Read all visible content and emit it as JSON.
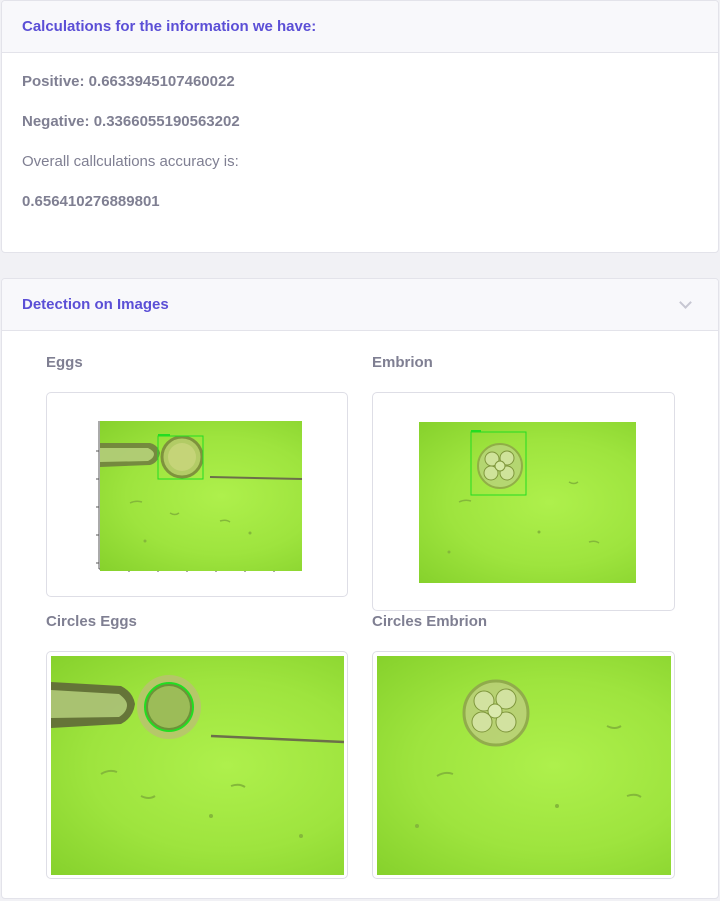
{
  "calculations": {
    "header_title": "Calculations for the information we have:",
    "positive_text": "Positive: 0.6633945107460022",
    "negative_text": "Negative: 0.3366055190563202",
    "accuracy_label": "Overall callculations accuracy is:",
    "accuracy_value": "0.656410276889801"
  },
  "detection": {
    "header_title": "Detection on Images",
    "images": [
      {
        "label": "Eggs"
      },
      {
        "label": "Embrion"
      },
      {
        "label": "Circles Eggs"
      },
      {
        "label": "Circles Embrion"
      }
    ]
  },
  "colors": {
    "accent": "#5b4fd6",
    "text": "#7f7f92",
    "detection_box": "#22dd22",
    "microscope_field": "#a6eb45"
  }
}
